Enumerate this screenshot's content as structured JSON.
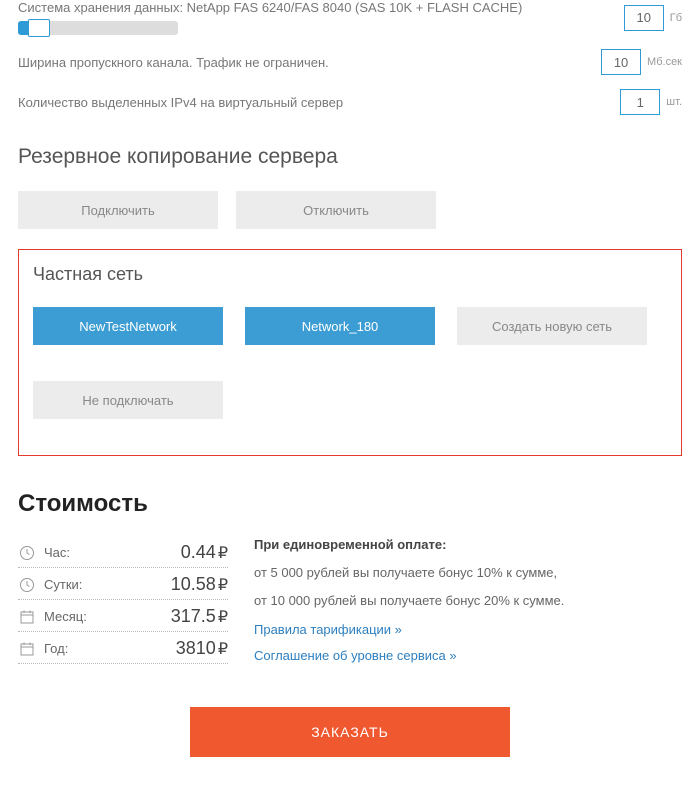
{
  "config": {
    "storage": {
      "label": "Система хранения данных: NetApp FAS 6240/FAS 8040 (SAS 10K + FLASH CACHE)",
      "value": "10",
      "unit": "Гб"
    },
    "bandwidth": {
      "label": "Ширина пропускного канала. Трафик не ограничен.",
      "value": "10",
      "unit": "Мб.сек"
    },
    "ipv4": {
      "label": "Количество выделенных IPv4 на виртуальный сервер",
      "value": "1",
      "unit": "шт."
    }
  },
  "backup": {
    "title": "Резервное копирование сервера",
    "enable": "Подключить",
    "disable": "Отключить"
  },
  "network": {
    "title": "Частная сеть",
    "new_test": "NewTestNetwork",
    "net180": "Network_180",
    "create": "Создать новую сеть",
    "disconnect": "Не подключать"
  },
  "cost": {
    "title": "Стоимость",
    "hour_label": "Час:",
    "hour_value": "0.44",
    "day_label": "Сутки:",
    "day_value": "10.58",
    "month_label": "Месяц:",
    "month_value": "317.5",
    "year_label": "Год:",
    "year_value": "3810",
    "currency": "₽"
  },
  "info": {
    "heading": "При единовременной оплате:",
    "bonus1": "от 5 000 рублей вы получаете бонус 10% к сумме,",
    "bonus2": "от 10 000 рублей вы получаете бонус 20% к сумме.",
    "tariff_link": "Правила тарификации »",
    "sla_link": "Соглашение об уровне сервиса »"
  },
  "order": {
    "label": "ЗАКАЗАТЬ"
  }
}
